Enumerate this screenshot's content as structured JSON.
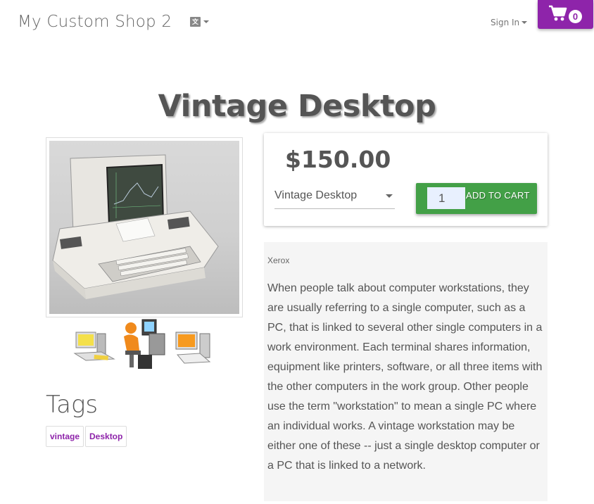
{
  "shop": {
    "name": "My Custom Shop 2"
  },
  "nav": {
    "signin_label": "Sign In",
    "cart_count": "0"
  },
  "product": {
    "title": "Vintage Desktop",
    "price": "$150.00",
    "variant": "Vintage Desktop",
    "quantity": "1",
    "add_to_cart_label": "ADD TO CART",
    "vendor": "Xerox",
    "description": "When people talk about computer workstations, they are usually referring to a single computer, such as a PC, that is linked to several other single computers in a work environment. Each terminal shares information, equipment like printers, software, or all three items with the other computers in the work group. Other people use the term \"workstation\" to mean a single PC where an individual works. A vintage workstation may be either one of these -- just a single desktop computer or a PC that is linked to a network."
  },
  "tags": {
    "title": "Tags",
    "items": [
      "vintage",
      "Desktop"
    ]
  },
  "colors": {
    "accent": "#8e24aa",
    "cart_button": "#43a047"
  },
  "icons": {
    "language": "translate-icon",
    "cart": "shopping-cart-icon"
  }
}
